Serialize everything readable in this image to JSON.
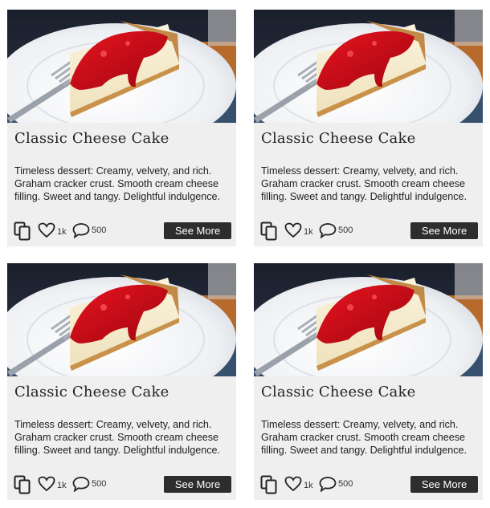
{
  "cards": [
    {
      "title": "Classic Cheese Cake",
      "description": "Timeless dessert: Creamy, velvety, and rich. Graham cracker crust. Smooth cream cheese filling. Sweet and tangy. Delightful indulgence.",
      "likes": "1k",
      "comments": "500",
      "button_label": "See More"
    },
    {
      "title": "Classic Cheese Cake",
      "description": "Timeless dessert: Creamy, velvety, and rich. Graham cracker crust. Smooth cream cheese filling. Sweet and tangy. Delightful indulgence.",
      "likes": "1k",
      "comments": "500",
      "button_label": "See More"
    },
    {
      "title": "Classic Cheese Cake",
      "description": "Timeless dessert: Creamy, velvety, and rich. Graham cracker crust. Smooth cream cheese filling. Sweet and tangy. Delightful indulgence.",
      "likes": "1k",
      "comments": "500",
      "button_label": "See More"
    },
    {
      "title": "Classic Cheese Cake",
      "description": "Timeless dessert: Creamy, velvety, and rich. Graham cracker crust. Smooth cream cheese filling. Sweet and tangy. Delightful indulgence.",
      "likes": "1k",
      "comments": "500",
      "button_label": "See More"
    }
  ],
  "icons": {
    "copy": "copy-icon",
    "like": "heart-icon",
    "comment": "comment-bubble-icon"
  },
  "colors": {
    "card_background": "#efefef",
    "button_background": "#2d2d2d",
    "button_text": "#ffffff"
  }
}
